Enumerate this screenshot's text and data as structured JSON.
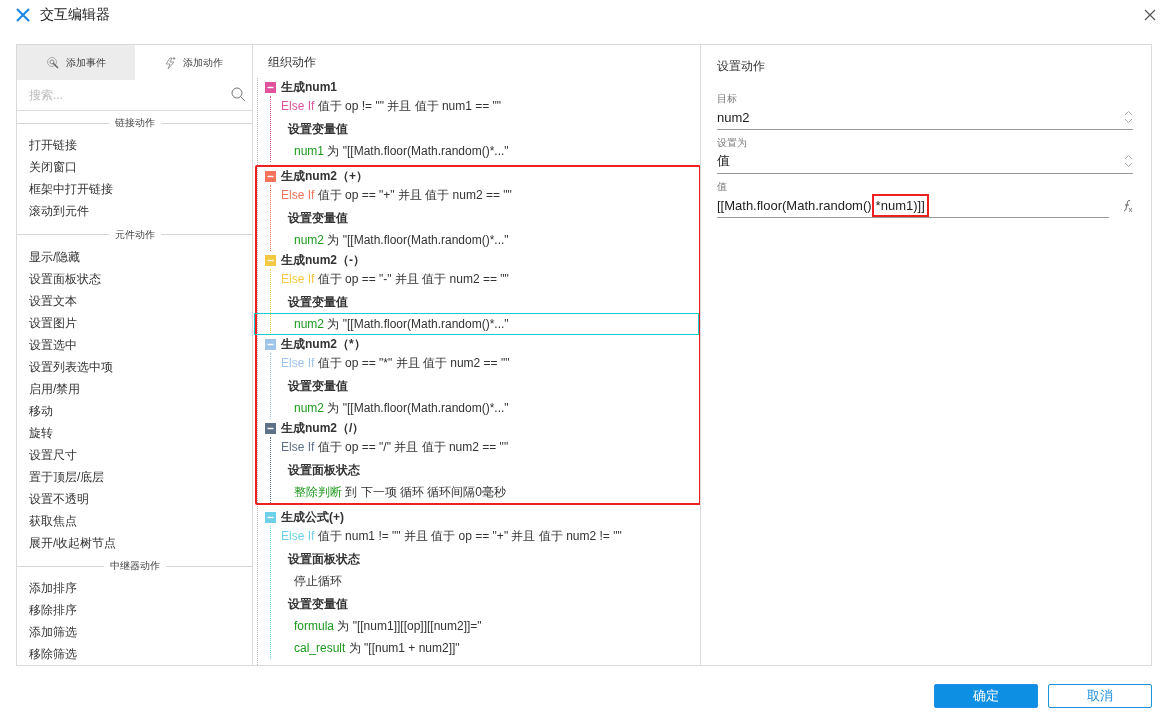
{
  "window": {
    "title": "交互编辑器"
  },
  "left": {
    "tabs": [
      {
        "label": "添加事件",
        "selected": true,
        "kind": "event"
      },
      {
        "label": "添加动作",
        "selected": false,
        "kind": "action"
      }
    ],
    "search": {
      "placeholder": "搜索..."
    },
    "groups": [
      {
        "title": "链接动作",
        "items": [
          "打开链接",
          "关闭窗口",
          "框架中打开链接",
          "滚动到元件"
        ]
      },
      {
        "title": "元件动作",
        "items": [
          "显示/隐藏",
          "设置面板状态",
          "设置文本",
          "设置图片",
          "设置选中",
          "设置列表选中项",
          "启用/禁用",
          "移动",
          "旋转",
          "设置尺寸",
          "置于顶层/底层",
          "设置不透明",
          "获取焦点",
          "展开/收起树节点"
        ]
      },
      {
        "title": "中继器动作",
        "items": [
          "添加排序",
          "移除排序",
          "添加筛选",
          "移除筛选"
        ]
      }
    ]
  },
  "middle": {
    "title": "组织动作",
    "cases": [
      {
        "name": "生成num1",
        "color": "#e0529c",
        "expanded": true,
        "highlighted": false,
        "keyword": "Else If",
        "condition": "值于 op != \"\" 并且 值于 num1 == \"\"",
        "actions": [
          {
            "title": "设置变量值",
            "lines": [
              {
                "target": "num1",
                "rest": "为 \"[[Math.floor(Math.random()*...\"",
                "selected": false
              }
            ]
          }
        ]
      },
      {
        "name": "生成num2（+）",
        "color": "#f4735a",
        "expanded": true,
        "highlighted": true,
        "keyword": "Else If",
        "condition": "值于 op == \"+\" 并且 值于 num2 == \"\"",
        "actions": [
          {
            "title": "设置变量值",
            "lines": [
              {
                "target": "num2",
                "rest": "为 \"[[Math.floor(Math.random()*...\"",
                "selected": false
              }
            ]
          }
        ]
      },
      {
        "name": "生成num2（-）",
        "color": "#f5c842",
        "expanded": true,
        "highlighted": true,
        "keyword": "Else If",
        "condition": "值于 op == \"-\" 并且 值于 num2 == \"\"",
        "actions": [
          {
            "title": "设置变量值",
            "lines": [
              {
                "target": "num2",
                "rest": "为 \"[[Math.floor(Math.random()*...\"",
                "selected": true
              }
            ]
          }
        ]
      },
      {
        "name": "生成num2（*）",
        "color": "#9ec4ea",
        "expanded": true,
        "highlighted": true,
        "keyword": "Else If",
        "condition": "值于 op == \"*\" 并且 值于 num2 == \"\"",
        "actions": [
          {
            "title": "设置变量值",
            "lines": [
              {
                "target": "num2",
                "rest": "为 \"[[Math.floor(Math.random()*...\"",
                "selected": false
              }
            ]
          }
        ]
      },
      {
        "name": "生成num2（/）",
        "color": "#5f7089",
        "expanded": true,
        "highlighted": true,
        "keyword": "Else If",
        "condition": "值于 op == \"/\" 并且 值于 num2 == \"\"",
        "actions": [
          {
            "title": "设置面板状态",
            "lines": [
              {
                "target": "整除判断",
                "rest": "到 下一项 循环 循环间隔0毫秒",
                "selected": false
              }
            ]
          }
        ]
      },
      {
        "name": "生成公式(+)",
        "color": "#6fd0ea",
        "expanded": true,
        "highlighted": false,
        "keyword": "Else If",
        "condition": "值于 num1 != \"\" 并且 值于 op == \"+\" 并且 值于 num2 != \"\"",
        "actions": [
          {
            "title": "设置面板状态",
            "lines": [
              {
                "rest": "停止循环",
                "selected": false
              }
            ]
          },
          {
            "title": "设置变量值",
            "lines": [
              {
                "target": "formula",
                "rest": "为 \"[[num1]][[op]][[num2]]=\"",
                "selected": false
              },
              {
                "target": "cal_result",
                "rest": "为 \"[[num1 + num2]]\"",
                "selected": false
              }
            ]
          }
        ]
      }
    ]
  },
  "right": {
    "title": "设置动作",
    "fields": [
      {
        "label": "目标",
        "kind": "select",
        "value": "num2"
      },
      {
        "label": "设置为",
        "kind": "select",
        "value": "值"
      },
      {
        "label": "值",
        "kind": "expression",
        "value_parts": [
          {
            "text": "[[Math.floor(Math.random()",
            "highlighted": false
          },
          {
            "text": "*num1)]]",
            "highlighted": true
          }
        ]
      }
    ]
  },
  "buttons": [
    {
      "label": "确定",
      "kind": "primary"
    },
    {
      "label": "取消",
      "kind": "secondary"
    }
  ]
}
